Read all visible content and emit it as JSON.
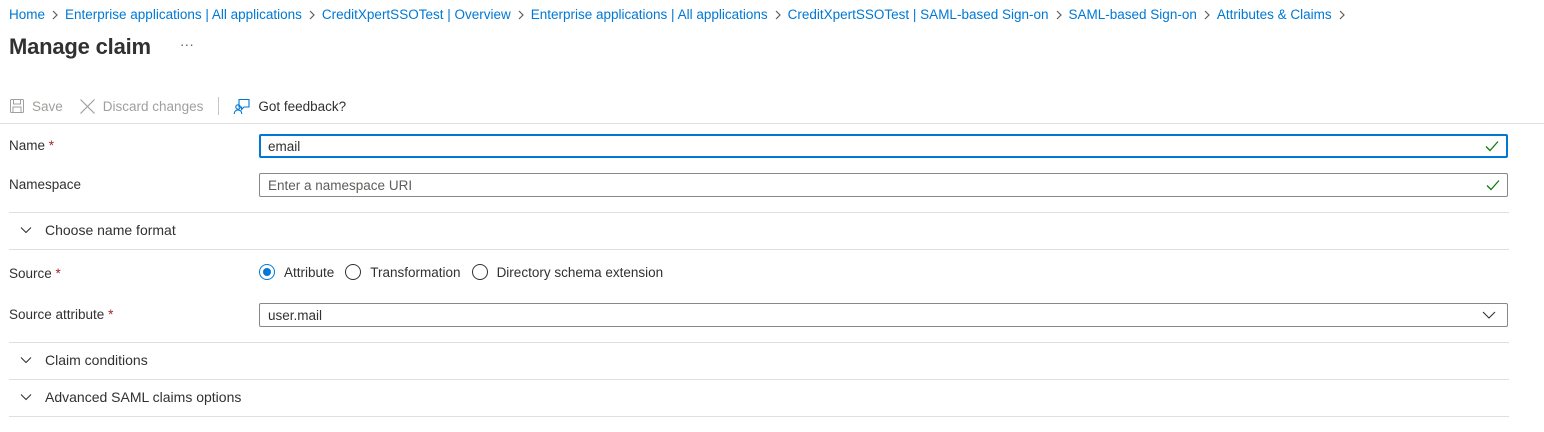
{
  "breadcrumb": [
    "Home",
    "Enterprise applications | All applications",
    "CreditXpertSSOTest | Overview",
    "Enterprise applications | All applications",
    "CreditXpertSSOTest | SAML-based Sign-on",
    "SAML-based Sign-on",
    "Attributes & Claims"
  ],
  "page": {
    "title": "Manage claim",
    "more_label": "···"
  },
  "toolbar": {
    "save_label": "Save",
    "discard_label": "Discard changes",
    "feedback_label": "Got feedback?"
  },
  "form": {
    "name": {
      "label": "Name",
      "required_mark": "*",
      "value": "email"
    },
    "namespace": {
      "label": "Namespace",
      "value": "",
      "placeholder": "Enter a namespace URI"
    },
    "name_format": {
      "label": "Choose name format"
    },
    "source": {
      "label": "Source",
      "required_mark": "*",
      "options": [
        "Attribute",
        "Transformation",
        "Directory schema extension"
      ],
      "selected": "Attribute"
    },
    "source_attribute": {
      "label": "Source attribute",
      "required_mark": "*",
      "value": "user.mail"
    },
    "claim_conditions": {
      "label": "Claim conditions"
    },
    "advanced_options": {
      "label": "Advanced SAML claims options"
    }
  },
  "colors": {
    "accent": "#0078d4",
    "valid_check": "#107c10",
    "required": "#a4262c",
    "disabled_text": "#a19f9d"
  },
  "icons": {
    "save": "save-icon",
    "discard": "close-icon",
    "feedback": "feedback-icon",
    "valid": "checkmark-icon",
    "expand": "chevron-down-icon",
    "dropdown": "chevron-down-icon"
  }
}
